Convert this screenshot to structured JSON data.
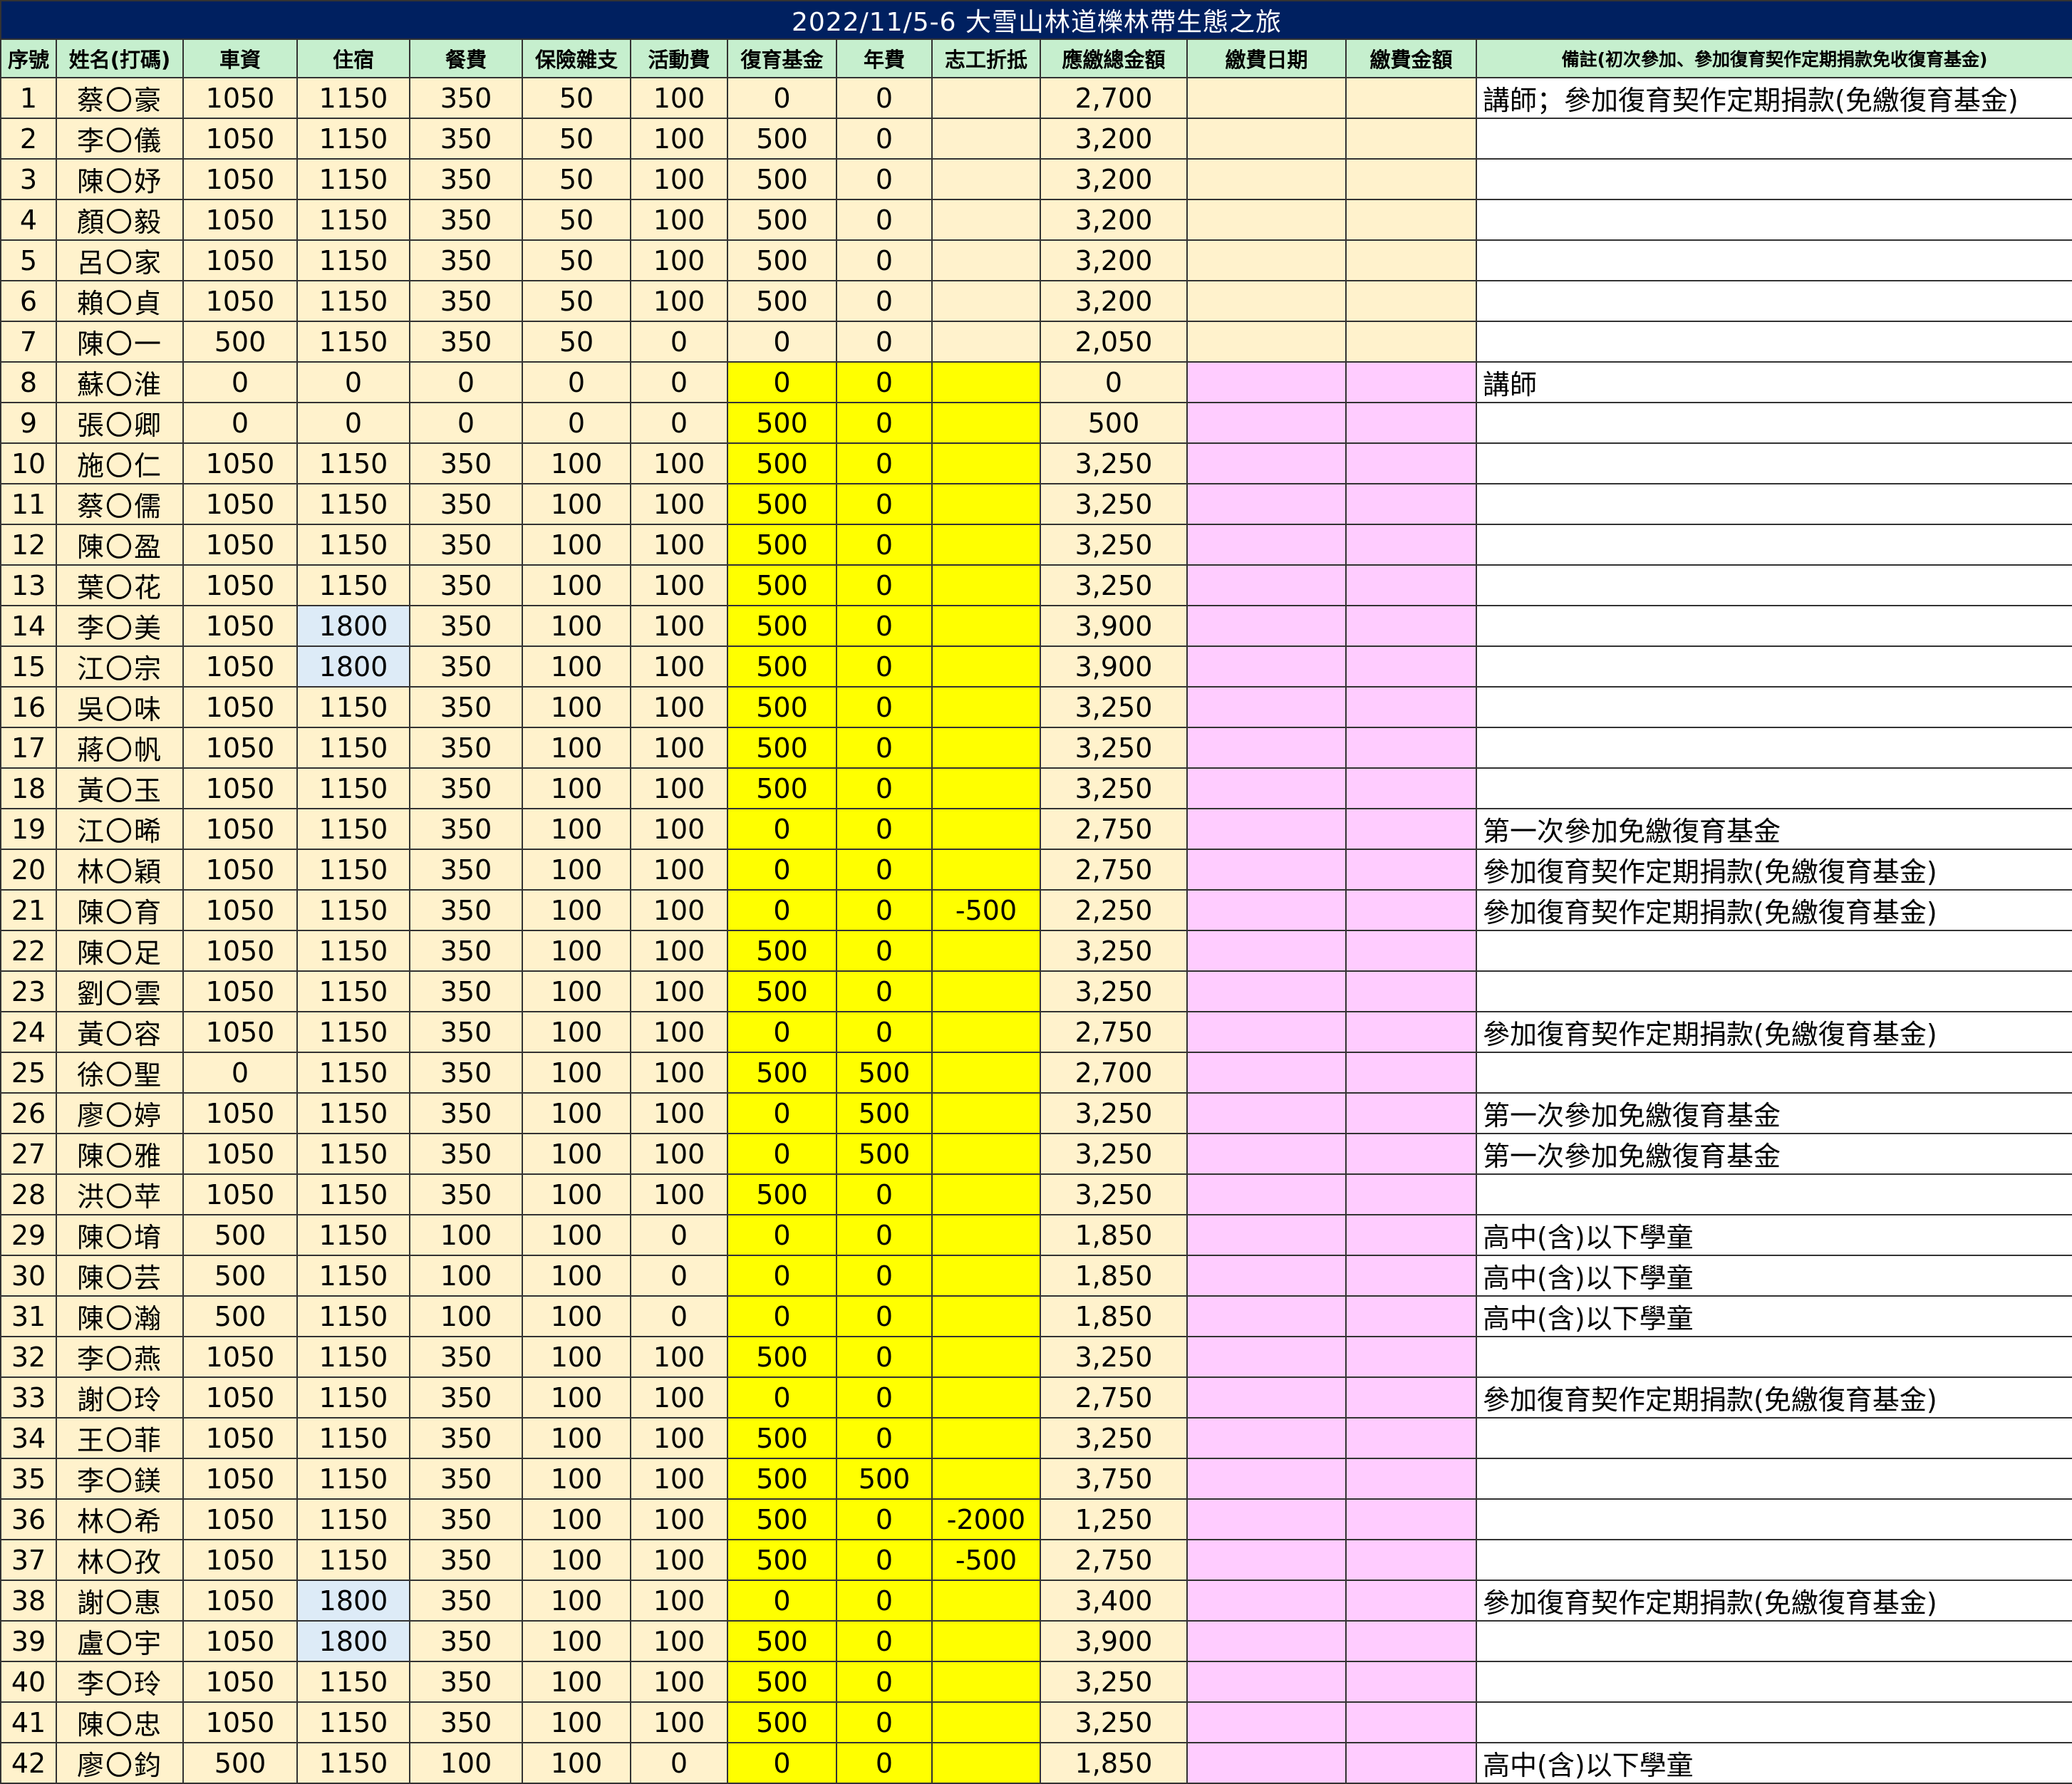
{
  "sheet": {
    "title": "2022/11/5-6 大雪山林道櫟林帶生態之旅",
    "columns": [
      "序號",
      "姓名(打碼)",
      "車資",
      "住宿",
      "餐費",
      "保險雜支",
      "活動費",
      "復育基金",
      "年費",
      "志工折抵",
      "應繳總金額",
      "繳費日期",
      "繳費金額",
      "備註(初次參加、參加復育契作定期捐款免收復育基金)"
    ],
    "colors": {
      "title_bg": "#002060",
      "header_bg": "#c6efce",
      "beige": "#fff2cc",
      "yellow": "#ffff00",
      "pink": "#ffccff",
      "light_blue": "#ddebf7"
    },
    "rows": [
      [
        "1",
        "蔡〇豪",
        "1050",
        "1150",
        "350",
        "50",
        "100",
        "0",
        "0",
        "",
        "2,700",
        "",
        "",
        "講師；參加復育契作定期捐款(免繳復育基金)"
      ],
      [
        "2",
        "李〇儀",
        "1050",
        "1150",
        "350",
        "50",
        "100",
        "500",
        "0",
        "",
        "3,200",
        "",
        "",
        ""
      ],
      [
        "3",
        "陳〇妤",
        "1050",
        "1150",
        "350",
        "50",
        "100",
        "500",
        "0",
        "",
        "3,200",
        "",
        "",
        ""
      ],
      [
        "4",
        "顏〇毅",
        "1050",
        "1150",
        "350",
        "50",
        "100",
        "500",
        "0",
        "",
        "3,200",
        "",
        "",
        ""
      ],
      [
        "5",
        "呂〇家",
        "1050",
        "1150",
        "350",
        "50",
        "100",
        "500",
        "0",
        "",
        "3,200",
        "",
        "",
        ""
      ],
      [
        "6",
        "賴〇貞",
        "1050",
        "1150",
        "350",
        "50",
        "100",
        "500",
        "0",
        "",
        "3,200",
        "",
        "",
        ""
      ],
      [
        "7",
        "陳〇一",
        "500",
        "1150",
        "350",
        "50",
        "0",
        "0",
        "0",
        "",
        "2,050",
        "",
        "",
        ""
      ],
      [
        "8",
        "蘇〇淮",
        "0",
        "0",
        "0",
        "0",
        "0",
        "0",
        "0",
        "",
        "0",
        "",
        "",
        "講師"
      ],
      [
        "9",
        "張〇卿",
        "0",
        "0",
        "0",
        "0",
        "0",
        "500",
        "0",
        "",
        "500",
        "",
        "",
        ""
      ],
      [
        "10",
        "施〇仁",
        "1050",
        "1150",
        "350",
        "100",
        "100",
        "500",
        "0",
        "",
        "3,250",
        "",
        "",
        ""
      ],
      [
        "11",
        "蔡〇儒",
        "1050",
        "1150",
        "350",
        "100",
        "100",
        "500",
        "0",
        "",
        "3,250",
        "",
        "",
        ""
      ],
      [
        "12",
        "陳〇盈",
        "1050",
        "1150",
        "350",
        "100",
        "100",
        "500",
        "0",
        "",
        "3,250",
        "",
        "",
        ""
      ],
      [
        "13",
        "葉〇花",
        "1050",
        "1150",
        "350",
        "100",
        "100",
        "500",
        "0",
        "",
        "3,250",
        "",
        "",
        ""
      ],
      [
        "14",
        "李〇美",
        "1050",
        "1800",
        "350",
        "100",
        "100",
        "500",
        "0",
        "",
        "3,900",
        "",
        "",
        ""
      ],
      [
        "15",
        "江〇宗",
        "1050",
        "1800",
        "350",
        "100",
        "100",
        "500",
        "0",
        "",
        "3,900",
        "",
        "",
        ""
      ],
      [
        "16",
        "吳〇味",
        "1050",
        "1150",
        "350",
        "100",
        "100",
        "500",
        "0",
        "",
        "3,250",
        "",
        "",
        ""
      ],
      [
        "17",
        "蔣〇帆",
        "1050",
        "1150",
        "350",
        "100",
        "100",
        "500",
        "0",
        "",
        "3,250",
        "",
        "",
        ""
      ],
      [
        "18",
        "黃〇玉",
        "1050",
        "1150",
        "350",
        "100",
        "100",
        "500",
        "0",
        "",
        "3,250",
        "",
        "",
        ""
      ],
      [
        "19",
        "江〇晞",
        "1050",
        "1150",
        "350",
        "100",
        "100",
        "0",
        "0",
        "",
        "2,750",
        "",
        "",
        "第一次參加免繳復育基金"
      ],
      [
        "20",
        "林〇穎",
        "1050",
        "1150",
        "350",
        "100",
        "100",
        "0",
        "0",
        "",
        "2,750",
        "",
        "",
        "參加復育契作定期捐款(免繳復育基金)"
      ],
      [
        "21",
        "陳〇育",
        "1050",
        "1150",
        "350",
        "100",
        "100",
        "0",
        "0",
        "-500",
        "2,250",
        "",
        "",
        "參加復育契作定期捐款(免繳復育基金)"
      ],
      [
        "22",
        "陳〇足",
        "1050",
        "1150",
        "350",
        "100",
        "100",
        "500",
        "0",
        "",
        "3,250",
        "",
        "",
        ""
      ],
      [
        "23",
        "劉〇雲",
        "1050",
        "1150",
        "350",
        "100",
        "100",
        "500",
        "0",
        "",
        "3,250",
        "",
        "",
        ""
      ],
      [
        "24",
        "黃〇容",
        "1050",
        "1150",
        "350",
        "100",
        "100",
        "0",
        "0",
        "",
        "2,750",
        "",
        "",
        "參加復育契作定期捐款(免繳復育基金)"
      ],
      [
        "25",
        "徐〇聖",
        "0",
        "1150",
        "350",
        "100",
        "100",
        "500",
        "500",
        "",
        "2,700",
        "",
        "",
        ""
      ],
      [
        "26",
        "廖〇婷",
        "1050",
        "1150",
        "350",
        "100",
        "100",
        "0",
        "500",
        "",
        "3,250",
        "",
        "",
        "第一次參加免繳復育基金"
      ],
      [
        "27",
        "陳〇雅",
        "1050",
        "1150",
        "350",
        "100",
        "100",
        "0",
        "500",
        "",
        "3,250",
        "",
        "",
        "第一次參加免繳復育基金"
      ],
      [
        "28",
        "洪〇苹",
        "1050",
        "1150",
        "350",
        "100",
        "100",
        "500",
        "0",
        "",
        "3,250",
        "",
        "",
        ""
      ],
      [
        "29",
        "陳〇堉",
        "500",
        "1150",
        "100",
        "100",
        "0",
        "0",
        "0",
        "",
        "1,850",
        "",
        "",
        "高中(含)以下學童"
      ],
      [
        "30",
        "陳〇芸",
        "500",
        "1150",
        "100",
        "100",
        "0",
        "0",
        "0",
        "",
        "1,850",
        "",
        "",
        "高中(含)以下學童"
      ],
      [
        "31",
        "陳〇瀚",
        "500",
        "1150",
        "100",
        "100",
        "0",
        "0",
        "0",
        "",
        "1,850",
        "",
        "",
        "高中(含)以下學童"
      ],
      [
        "32",
        "李〇燕",
        "1050",
        "1150",
        "350",
        "100",
        "100",
        "500",
        "0",
        "",
        "3,250",
        "",
        "",
        ""
      ],
      [
        "33",
        "謝〇玲",
        "1050",
        "1150",
        "350",
        "100",
        "100",
        "0",
        "0",
        "",
        "2,750",
        "",
        "",
        "參加復育契作定期捐款(免繳復育基金)"
      ],
      [
        "34",
        "王〇菲",
        "1050",
        "1150",
        "350",
        "100",
        "100",
        "500",
        "0",
        "",
        "3,250",
        "",
        "",
        ""
      ],
      [
        "35",
        "李〇鎂",
        "1050",
        "1150",
        "350",
        "100",
        "100",
        "500",
        "500",
        "",
        "3,750",
        "",
        "",
        ""
      ],
      [
        "36",
        "林〇希",
        "1050",
        "1150",
        "350",
        "100",
        "100",
        "500",
        "0",
        "-2000",
        "1,250",
        "",
        "",
        ""
      ],
      [
        "37",
        "林〇孜",
        "1050",
        "1150",
        "350",
        "100",
        "100",
        "500",
        "0",
        "-500",
        "2,750",
        "",
        "",
        ""
      ],
      [
        "38",
        "謝〇惠",
        "1050",
        "1800",
        "350",
        "100",
        "100",
        "0",
        "0",
        "",
        "3,400",
        "",
        "",
        "參加復育契作定期捐款(免繳復育基金)"
      ],
      [
        "39",
        "盧〇宇",
        "1050",
        "1800",
        "350",
        "100",
        "100",
        "500",
        "0",
        "",
        "3,900",
        "",
        "",
        ""
      ],
      [
        "40",
        "李〇玲",
        "1050",
        "1150",
        "350",
        "100",
        "100",
        "500",
        "0",
        "",
        "3,250",
        "",
        "",
        ""
      ],
      [
        "41",
        "陳〇忠",
        "1050",
        "1150",
        "350",
        "100",
        "100",
        "500",
        "0",
        "",
        "3,250",
        "",
        "",
        ""
      ],
      [
        "42",
        "廖〇鈞",
        "500",
        "1150",
        "100",
        "100",
        "0",
        "0",
        "0",
        "",
        "1,850",
        "",
        "",
        "高中(含)以下學童"
      ]
    ]
  }
}
